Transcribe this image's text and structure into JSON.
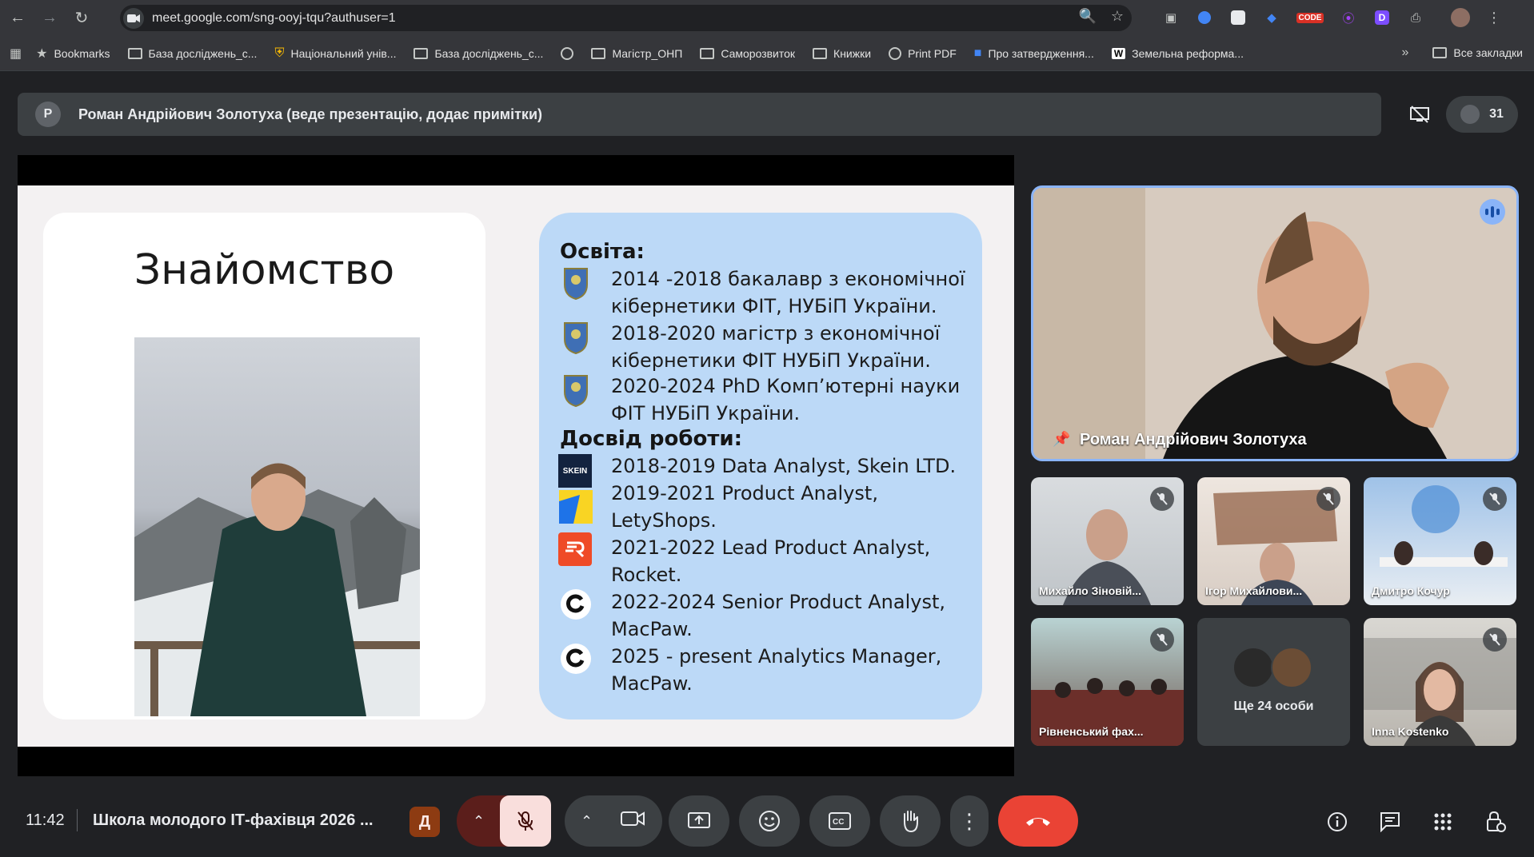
{
  "browser": {
    "url": "meet.google.com/sng-ooyj-tqu?authuser=1",
    "ext_code_label": "CODE",
    "bookmarks": [
      {
        "label": "Bookmarks",
        "icon": "star-icon"
      },
      {
        "label": "База досліджень_с...",
        "icon": "folder-icon"
      },
      {
        "label": "Національний унів...",
        "icon": "shield-icon"
      },
      {
        "label": "База досліджень_с...",
        "icon": "folder-icon"
      },
      {
        "label": "",
        "icon": "globe-icon"
      },
      {
        "label": "Магістр_ОНП",
        "icon": "folder-icon"
      },
      {
        "label": "Саморозвиток",
        "icon": "folder-icon"
      },
      {
        "label": "Книжки",
        "icon": "folder-icon"
      },
      {
        "label": "Print PDF",
        "icon": "globe-icon"
      },
      {
        "label": "Про затвердження...",
        "icon": "site-icon"
      },
      {
        "label": "Земельна реформа...",
        "icon": "w-icon"
      }
    ],
    "all_bookmarks": "Все закладки"
  },
  "meet": {
    "presenter_initial": "P",
    "presenter_text": "Роман Андрійович Золотуха (веде презентацію, додає примітки)",
    "participant_count": "31",
    "clock": "11:42",
    "meeting_title": "Школа молодого ІТ-фахівця 2026 ...",
    "host_badge": "Д"
  },
  "slide": {
    "title": "Знайомство",
    "education_heading": "Освіта:",
    "education": [
      "2014 -2018 бакалавр з економічної кібернетики ФІТ, НУБіП України.",
      "2018-2020 магістр з економічної кібернетики ФІТ НУБіП України.",
      "2020-2024 PhD Комп’ютерні науки ФІТ НУБіП України."
    ],
    "work_heading": "Досвід роботи:",
    "work": [
      {
        "text": "2018-2019 Data Analyst, Skein LTD.",
        "logo": "skein-logo",
        "logo_text": "SKEIN"
      },
      {
        "text": "2019-2021 Product Analyst, LetyShops.",
        "logo": "letyshops-logo",
        "logo_text": ""
      },
      {
        "text": "2021-2022 Lead Product Analyst, Rocket.",
        "logo": "rocket-logo",
        "logo_text": ""
      },
      {
        "text": "2022-2024 Senior Product Analyst, MacPaw.",
        "logo": "macpaw-logo",
        "logo_text": ""
      },
      {
        "text": "2025 - present Analytics Manager, MacPaw.",
        "logo": "macpaw-logo",
        "logo_text": ""
      }
    ]
  },
  "participants": {
    "main": "Роман Андрійович Золотуха",
    "tiles": [
      "Михайло Зіновій...",
      "Ігор Михайлови...",
      "Дмитро Кочур",
      "Рівненський фах...",
      "Ще 24 особи",
      "Inna Kostenko"
    ]
  },
  "colors": {
    "slide_card_right": "#bcd9f7",
    "end_call": "#ea4335",
    "mic_off": "#f9dedc",
    "focus_border": "#8ab4f8"
  }
}
